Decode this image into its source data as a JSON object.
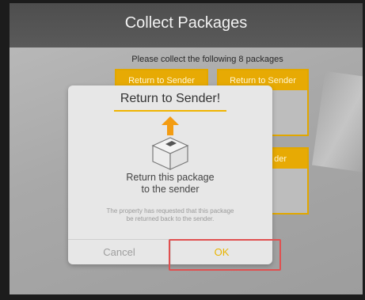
{
  "header": {
    "title": "Collect Packages"
  },
  "instruction": "Please collect the following 8 packages",
  "packages": [
    {
      "label": "Return to Sender"
    },
    {
      "label": "Return to Sender"
    },
    {
      "label": "der"
    }
  ],
  "dialog": {
    "title": "Return to Sender!",
    "icons": {
      "arrow": "arrow-up-icon",
      "box": "package-box-icon"
    },
    "message_line1": "Return this package",
    "message_line2": "to the sender",
    "detail_line1": "The property has requested that this package",
    "detail_line2": "be returned back to the sender.",
    "cancel_label": "Cancel",
    "ok_label": "OK"
  },
  "colors": {
    "accent": "#E7AA04",
    "header_bg": "#555555",
    "highlight": "#E05050"
  }
}
